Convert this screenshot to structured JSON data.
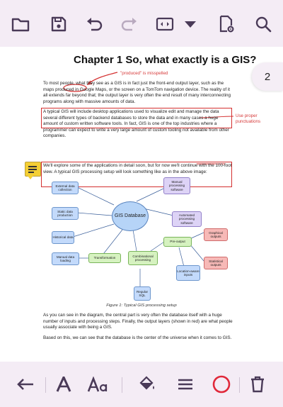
{
  "toolbar": {
    "items": [
      "folder-icon",
      "save-icon",
      "undo-icon",
      "redo-icon",
      "fit-width-icon",
      "dropdown-icon",
      "document-settings-icon",
      "search-icon"
    ]
  },
  "page_indicator": "2",
  "document": {
    "title": "Chapter 1  So, what exactly is a GIS?",
    "paragraph1": "To most people, what they see as a GIS is in fact just the front-end output layer, such as the maps produced in Google Maps, or the screen on a TomTom navigation device. The reality of it all extends far beyond that; the output layer is very often the end result of many interconnecting programs along with massive amounts of data.",
    "paragraph2": "A typical GIS will include desktop applications used to visualize edit and manage the data several different types of backend databases to store the data and in many cases a huge amount of custom written software tools. In fact, GIS is one of the top industries where a programmer can expect to write a very large amount of custom tooling not available from other companies.",
    "paragraph3": "We'll explore some of the applications in detail soon, but for now we'll continue with the 100-foot view. A typical GIS processing setup will look something like as in the above image:",
    "caption": "Figure 1: Typical GIS processing setup",
    "paragraph4": "As you can see in the diagram, the central part is very often the database itself with a huge number of inputs and processing steps. Finally, the output layers (shown in red) are what people usually associate with being a GIS.",
    "paragraph5": "Based on this, we can see that the database is the center of the universe when it comes to GIS."
  },
  "annotations": {
    "misspelled": "\"produced\" is misspelled",
    "punctuation": "Use proper punctuations"
  },
  "diagram": {
    "nodes": {
      "external": "External data collection",
      "static": "Static data production",
      "historical": "Historical data",
      "manual_loading": "Manual data loading",
      "database": "GIS Database",
      "transformation": "Transformation",
      "combinational": "Combinational processing",
      "regular_sql": "Regular SQL",
      "manual_processing": "Manual processing software",
      "automated_processing": "Automated processing software",
      "pre_output": "Pre-output",
      "graphical": "Graphical outputs",
      "statistical": "Statistical outputs",
      "location": "Location-aware inputs"
    }
  },
  "bottom_toolbar": {
    "items": [
      "back-arrow-icon",
      "text-icon",
      "font-size-icon",
      "fill-color-icon",
      "line-style-icon",
      "circle-shape-icon",
      "delete-icon"
    ]
  },
  "colors": {
    "annotation_red": "#d43030",
    "accent_purple": "#6b3f86"
  }
}
